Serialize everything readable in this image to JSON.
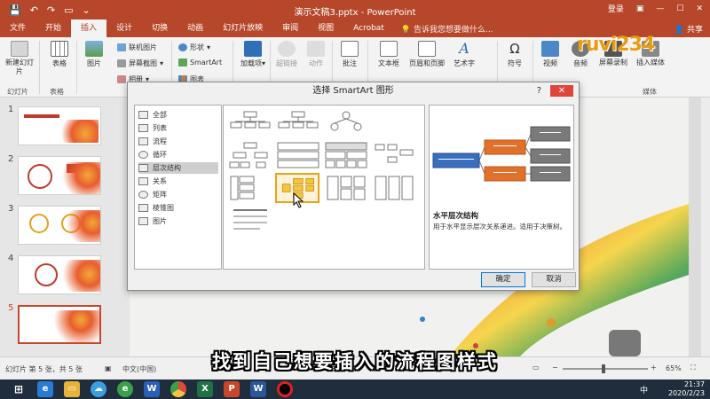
{
  "window": {
    "title": "演示文稿3.pptx - PowerPoint",
    "login": "登录",
    "share": "共享"
  },
  "tabs": [
    "文件",
    "开始",
    "插入",
    "设计",
    "切换",
    "动画",
    "幻灯片放映",
    "审阅",
    "视图",
    "Acrobat"
  ],
  "active_tab": "插入",
  "tellme": "告诉我您想要做什么...",
  "ribbon": {
    "new_slide": "新建幻灯片",
    "table": "表格",
    "image": "图片",
    "online_pic": "联机图片",
    "screenshot": "屏幕截图",
    "album": "相册",
    "shapes": "形状",
    "smartart": "SmartArt",
    "chart": "图表",
    "addins": "加载项",
    "hyperlink": "超链接",
    "action": "动作",
    "comment": "批注",
    "textbox": "文本框",
    "header_footer": "页眉和页脚",
    "wordart": "艺术字",
    "symbols": "符号",
    "video": "视频",
    "audio": "音频",
    "screen_rec": "屏幕录制",
    "insert_media": "插入媒体",
    "groups": {
      "slides": "幻灯片",
      "tables": "表格",
      "media": "媒体"
    }
  },
  "dialog": {
    "title": "选择 SmartArt 图形",
    "help": "?",
    "categories": [
      "全部",
      "列表",
      "流程",
      "循环",
      "层次结构",
      "关系",
      "矩阵",
      "棱锥图",
      "图片"
    ],
    "selected_category": "层次结构",
    "preview_title": "水平层次结构",
    "preview_desc": "用于水平显示层次关系递进。适用于决策树。",
    "ok": "确定",
    "cancel": "取消"
  },
  "slides": {
    "numbers": [
      "1",
      "2",
      "3",
      "4",
      "5"
    ],
    "selected": "5"
  },
  "status": {
    "slide_info": "幻灯片 第 5 张，共 5 张",
    "language": "中文(中国)",
    "zoom": "65%"
  },
  "caption": "找到自己想要插入的流程图样式",
  "watermark": "ruvi234",
  "taskbar": {
    "time": "21:37",
    "date": "2020/2/23",
    "ime": "中"
  },
  "colors": {
    "accent": "#b7472a",
    "preview_blue": "#3a6ebf",
    "preview_orange": "#e0702a",
    "preview_gray": "#7a7a7a",
    "gallery_selected": "#e8a317"
  }
}
